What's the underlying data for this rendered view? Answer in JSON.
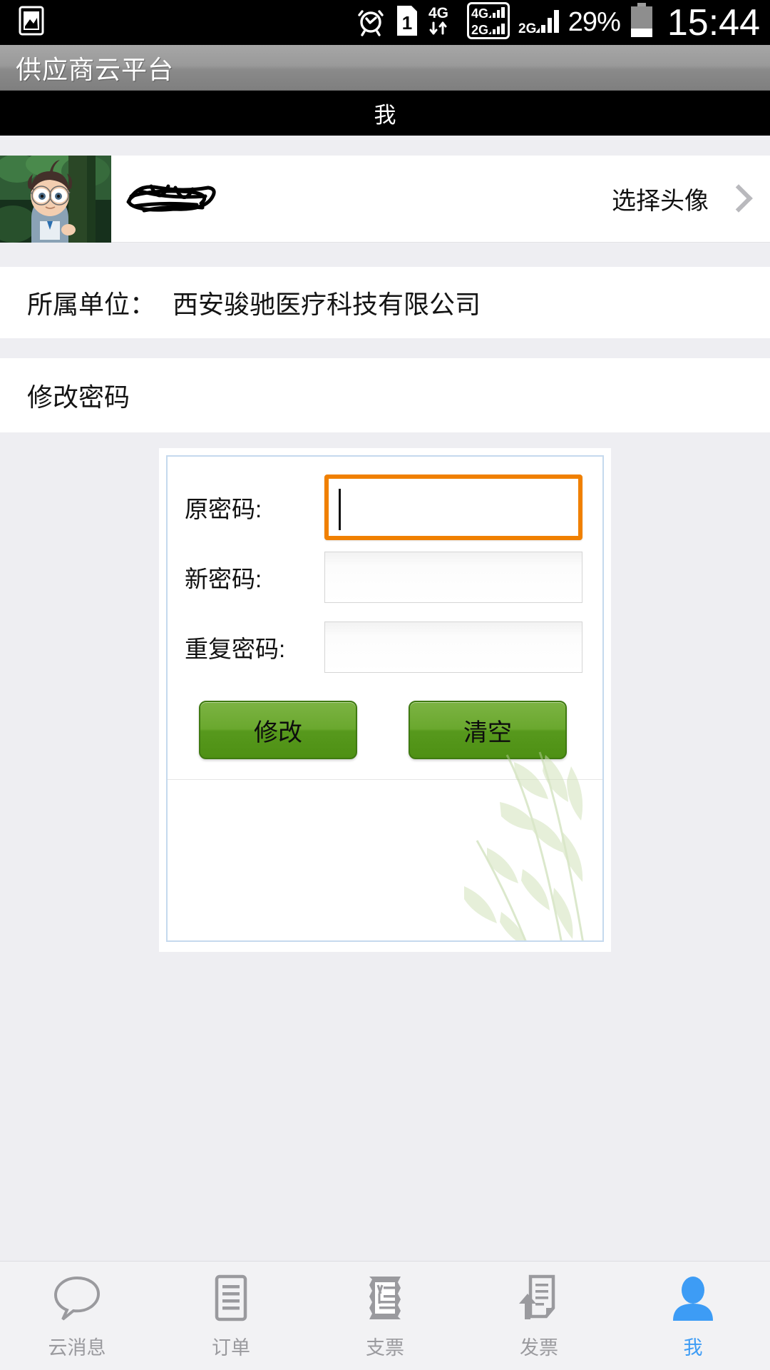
{
  "status_bar": {
    "alarm_icon": "alarm-clock-icon",
    "sim_icon": "sim-card-1-icon",
    "network_4g_label": "4G",
    "network_2g_label": "2G",
    "signal_2g_label": "2G",
    "battery_percent": "29%",
    "clock": "15:44",
    "screenshot_icon": "screenshot-icon"
  },
  "app_bar": {
    "title": "供应商云平台"
  },
  "section_bar": {
    "title": "我"
  },
  "profile": {
    "avatar_icon": "user-avatar-image",
    "username": "",
    "username_redacted": true,
    "select_avatar_label": "选择头像",
    "chevron_icon": "chevron-right-icon"
  },
  "company": {
    "label": "所属单位：",
    "value": "西安骏驰医疗科技有限公司"
  },
  "change_password": {
    "section_title": "修改密码",
    "fields": [
      {
        "label": "原密码:",
        "value": "",
        "focused": true
      },
      {
        "label": "新密码:",
        "value": "",
        "focused": false
      },
      {
        "label": "重复密码:",
        "value": "",
        "focused": false
      }
    ],
    "submit_label": "修改",
    "clear_label": "清空",
    "decoration_icon": "bamboo-leaves-decoration"
  },
  "colors": {
    "focus_orange": "#f08000",
    "button_green": "#6aa82e",
    "active_tab_blue": "#3d9cf5",
    "card_border_blue": "#c5d9ee",
    "page_background": "#eeeef2"
  },
  "bottom_nav": {
    "items": [
      {
        "label": "云消息",
        "icon": "speech-bubble-icon",
        "active": false
      },
      {
        "label": "订单",
        "icon": "order-document-icon",
        "active": false
      },
      {
        "label": "支票",
        "icon": "cheque-icon",
        "active": false
      },
      {
        "label": "发票",
        "icon": "invoice-upload-icon",
        "active": false
      },
      {
        "label": "我",
        "icon": "person-icon",
        "active": true
      }
    ]
  }
}
